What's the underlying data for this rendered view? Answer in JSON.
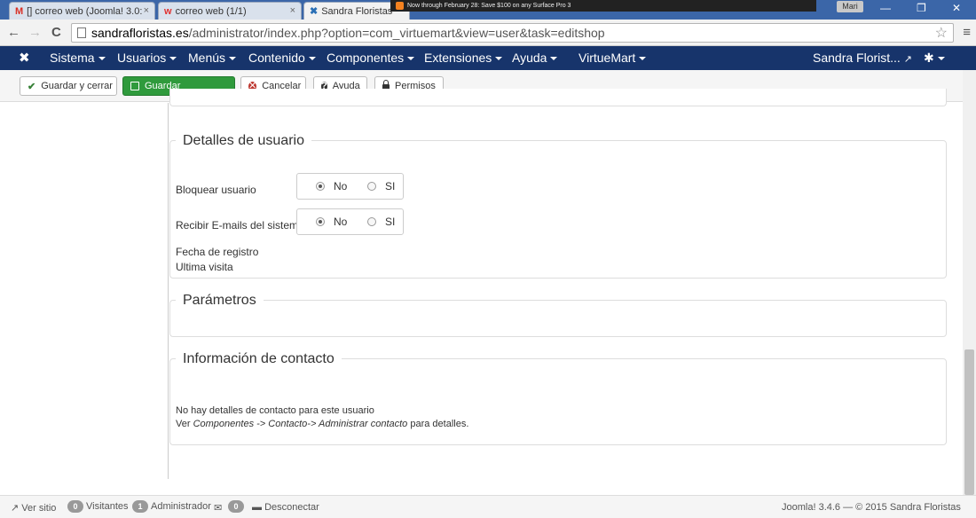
{
  "browser": {
    "tabs": [
      {
        "icon": "M",
        "title": "[] correo web (Joomla! 3.0:",
        "close": "×"
      },
      {
        "icon": "w",
        "title": "correo web (1/1)",
        "close": "×"
      },
      {
        "icon": "",
        "title": "Sandra Floristas",
        "close": "×"
      }
    ],
    "notification": "Now through February 28: Save $100 on any Surface Pro 3",
    "user": "Mari",
    "window_controls": {
      "minimize": "—",
      "restore": "❐",
      "close": "✕"
    },
    "url_host": "sandrafloristas.es",
    "url_path": "/administrator/index.php?option=com_virtuemart&view=user&task=editshop",
    "nav": {
      "back": "←",
      "forward": "→",
      "reload": "C"
    },
    "star": "☆",
    "menu": "≡"
  },
  "admin_nav": {
    "logo": "✖",
    "items": [
      "Sistema",
      "Usuarios",
      "Menús",
      "Contenido",
      "Componentes",
      "Extensiones",
      "Ayuda",
      "VirtueMart"
    ],
    "user": "Sandra Florist...",
    "external_icon": "↗",
    "gear": "✱"
  },
  "toolbar": {
    "save_close": "Guardar y cerrar",
    "save": "Guardar",
    "cancel": "Cancelar",
    "help": "Ayuda",
    "permissions": "Permisos"
  },
  "user_details": {
    "legend": "Detalles de usuario",
    "block_label": "Bloquear usuario",
    "system_emails_label": "Recibir E-mails del sistema",
    "option_no": "No",
    "option_yes": "SI",
    "block_value": "No",
    "system_emails_value": "No",
    "registration_date_label": "Fecha de registro",
    "last_visit_label": "Ultima visita"
  },
  "parameters": {
    "legend": "Parámetros"
  },
  "contact_info": {
    "legend": "Información de contacto",
    "no_details": "No hay detalles de contacto para este usuario",
    "see_prefix": "Ver",
    "path": "Componentes -> Contacto-> Administrar contacto",
    "see_suffix": "para detalles."
  },
  "footer": {
    "view_site": "Ver sitio",
    "visitors_count": "0",
    "visitors": "Visitantes",
    "admin_count": "1",
    "admin": "Administrador",
    "messages_count": "0",
    "logout": "Desconectar",
    "version": "Joomla! 3.4.6 — © 2015 Sandra Floristas"
  }
}
